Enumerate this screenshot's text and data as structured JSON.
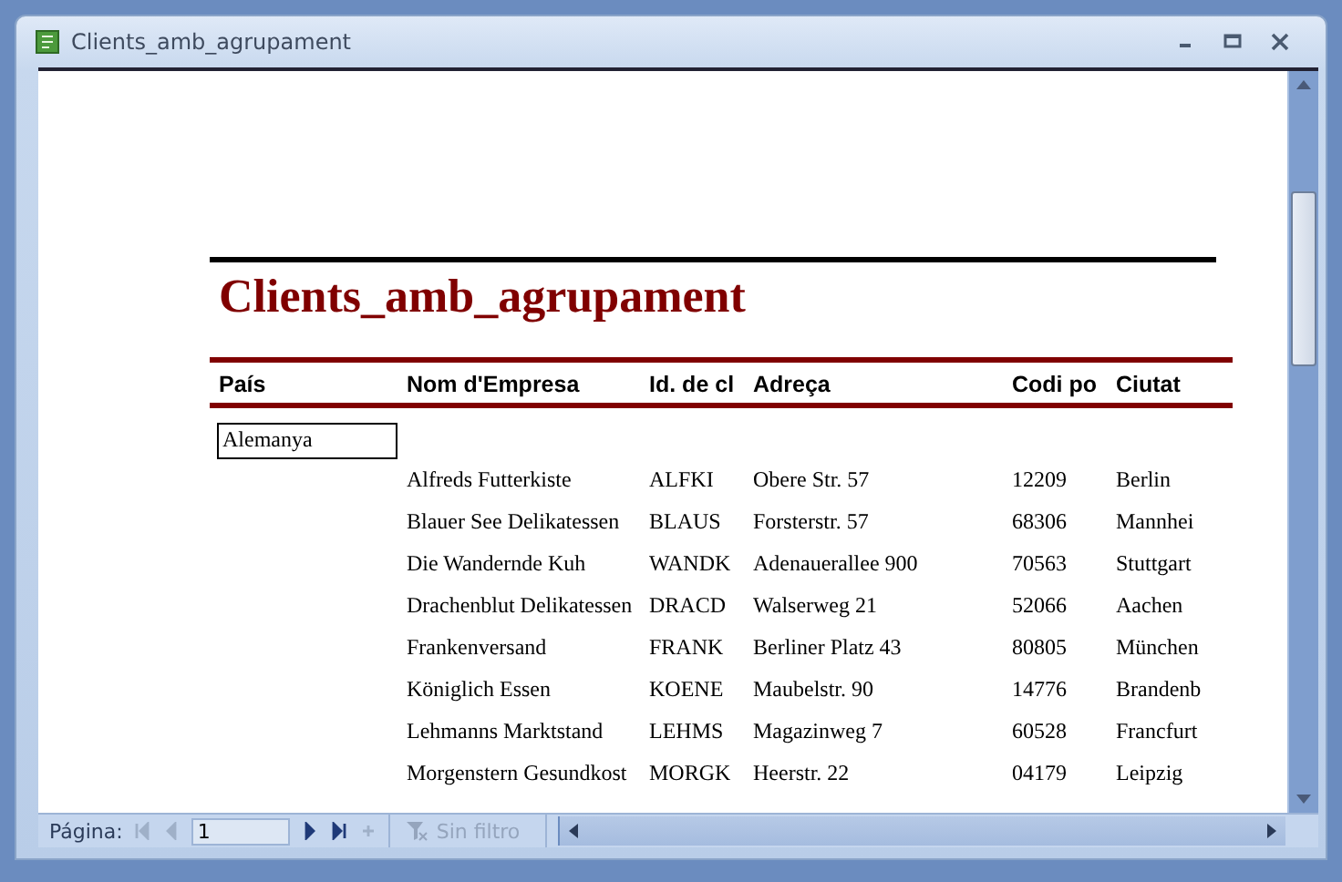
{
  "window": {
    "title": "Clients_amb_agrupament"
  },
  "report": {
    "title": "Clients_amb_agrupament",
    "columns": [
      "País",
      "Nom d'Empresa",
      "Id. de cl",
      "Adreça",
      "Codi po",
      "Ciutat"
    ],
    "groups": [
      {
        "country": "Alemanya",
        "rows": [
          [
            "Alfreds Futterkiste",
            "ALFKI",
            "Obere Str. 57",
            "12209",
            "Berlin"
          ],
          [
            "Blauer See Delikatessen",
            "BLAUS",
            "Forsterstr. 57",
            "68306",
            "Mannhei"
          ],
          [
            "Die Wandernde Kuh",
            "WANDK",
            "Adenauerallee 900",
            "70563",
            "Stuttgart"
          ],
          [
            "Drachenblut Delikatessen",
            "DRACD",
            "Walserweg 21",
            "52066",
            "Aachen"
          ],
          [
            "Frankenversand",
            "FRANK",
            "Berliner Platz 43",
            "80805",
            "München"
          ],
          [
            "Königlich Essen",
            "KOENE",
            "Maubelstr. 90",
            "14776",
            "Brandenb"
          ],
          [
            "Lehmanns Marktstand",
            "LEHMS",
            "Magazinweg 7",
            "60528",
            "Francfurt"
          ],
          [
            "Morgenstern Gesundkost",
            "MORGK",
            "Heerstr. 22",
            "04179",
            "Leipzig"
          ]
        ]
      }
    ]
  },
  "navigation": {
    "label": "Página:",
    "page": "1",
    "buttons": [
      {
        "kind": "first",
        "disabled": true
      },
      {
        "kind": "prev",
        "disabled": true
      },
      {
        "kind": "next",
        "disabled": false
      },
      {
        "kind": "last",
        "disabled": false
      },
      {
        "kind": "new",
        "disabled": true
      }
    ],
    "filter": {
      "label": "Sin filtro",
      "disabled": true
    }
  }
}
